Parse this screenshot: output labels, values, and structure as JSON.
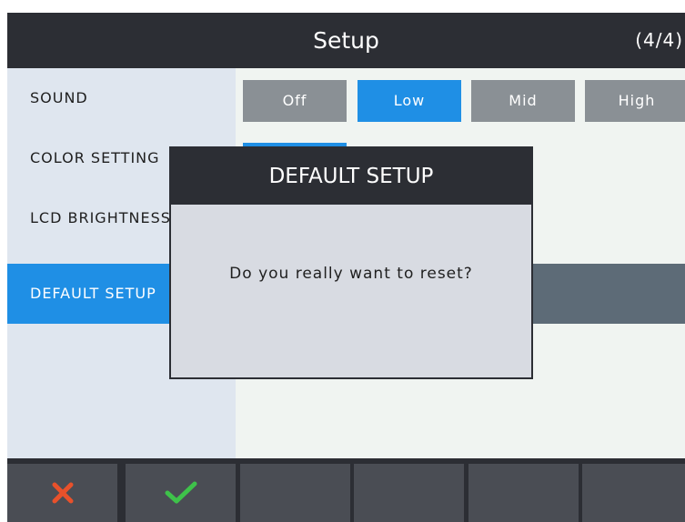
{
  "header": {
    "title": "Setup",
    "page_indicator": "(4/4)"
  },
  "sidebar": {
    "items": [
      {
        "label": "SOUND"
      },
      {
        "label": "COLOR SETTING"
      },
      {
        "label": "LCD BRIGHTNESS"
      },
      {
        "label": "DEFAULT SETUP"
      }
    ],
    "active_index": 3
  },
  "sound_options": {
    "options": [
      "Off",
      "Low",
      "Mid",
      "High"
    ],
    "selected": "Low"
  },
  "dialog": {
    "title": "DEFAULT SETUP",
    "message": "Do you really want to reset?"
  },
  "bottom_bar": {
    "buttons": [
      {
        "icon": "cancel-x-icon",
        "color": "#e8512b"
      },
      {
        "icon": "confirm-check-icon",
        "color": "#3ec24a"
      },
      {
        "icon": ""
      },
      {
        "icon": ""
      },
      {
        "icon": ""
      },
      {
        "icon": ""
      }
    ]
  },
  "colors": {
    "accent": "#1f8fe5",
    "header_bg": "#2c2e34",
    "inactive_option": "#8a9095"
  }
}
